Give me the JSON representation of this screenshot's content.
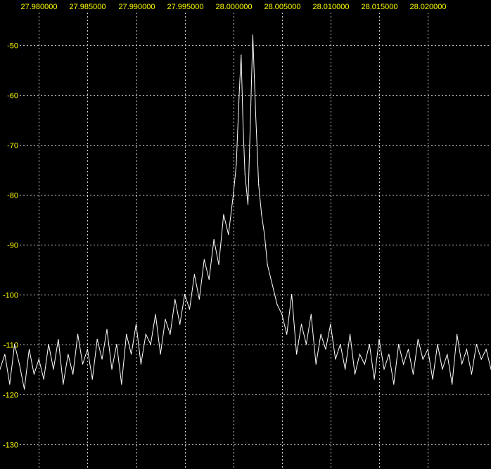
{
  "chart_data": {
    "type": "line",
    "title": "",
    "xlabel": "",
    "ylabel": "",
    "xlim": [
      27.976,
      28.0265
    ],
    "ylim": [
      -135,
      -41
    ],
    "grid": true,
    "x_ticks": [
      "27.980000",
      "27.985000",
      "27.990000",
      "27.995000",
      "28.000000",
      "28.005000",
      "28.010000",
      "28.015000",
      "28.020000"
    ],
    "y_ticks": [
      "-50",
      "-60",
      "-70",
      "-80",
      "-90",
      "-100",
      "-110",
      "-120",
      "-130"
    ],
    "series": [
      {
        "color": "#ffffff",
        "x": [
          27.976,
          27.9765,
          27.977,
          27.9775,
          27.978,
          27.9785,
          27.979,
          27.9795,
          27.98,
          27.9805,
          27.981,
          27.9815,
          27.982,
          27.9825,
          27.983,
          27.9835,
          27.984,
          27.9845,
          27.985,
          27.9855,
          27.986,
          27.9865,
          27.987,
          27.9875,
          27.988,
          27.9885,
          27.989,
          27.9895,
          27.99,
          27.9905,
          27.991,
          27.9915,
          27.992,
          27.9925,
          27.993,
          27.9935,
          27.994,
          27.9945,
          27.995,
          27.9955,
          27.996,
          27.9965,
          27.997,
          27.9975,
          27.998,
          27.9985,
          27.999,
          27.9995,
          28.0,
          28.0003,
          28.0006,
          28.0008,
          28.001,
          28.0012,
          28.0015,
          28.0018,
          28.002,
          28.0023,
          28.0026,
          28.0029,
          28.0032,
          28.0035,
          28.004,
          28.0045,
          28.005,
          28.0055,
          28.006,
          28.0065,
          28.007,
          28.0075,
          28.008,
          28.0085,
          28.009,
          28.0095,
          28.01,
          28.0105,
          28.011,
          28.0115,
          28.012,
          28.0125,
          28.013,
          28.0135,
          28.014,
          28.0145,
          28.015,
          28.0155,
          28.016,
          28.0165,
          28.017,
          28.0175,
          28.018,
          28.0185,
          28.019,
          28.0195,
          28.02,
          28.0205,
          28.021,
          28.0215,
          28.022,
          28.0225,
          28.023,
          28.0235,
          28.024,
          28.0245,
          28.025,
          28.0255,
          28.026,
          28.0265
        ],
        "y": [
          -115,
          -112,
          -118,
          -110,
          -114,
          -119,
          -111,
          -116,
          -113,
          -117,
          -110,
          -115,
          -109,
          -118,
          -112,
          -116,
          -108,
          -114,
          -111,
          -117,
          -109,
          -113,
          -107,
          -115,
          -110,
          -118,
          -108,
          -112,
          -106,
          -114,
          -108,
          -110,
          -104,
          -112,
          -105,
          -108,
          -101,
          -106,
          -100,
          -103,
          -96,
          -101,
          -93,
          -97,
          -89,
          -94,
          -84,
          -88,
          -80,
          -74,
          -60,
          -52,
          -66,
          -76,
          -82,
          -62,
          -48,
          -64,
          -78,
          -84,
          -88,
          -94,
          -98,
          -102,
          -104,
          -108,
          -100,
          -112,
          -106,
          -110,
          -104,
          -114,
          -108,
          -111,
          -106,
          -113,
          -110,
          -115,
          -108,
          -116,
          -112,
          -114,
          -110,
          -117,
          -109,
          -115,
          -112,
          -118,
          -110,
          -114,
          -111,
          -116,
          -109,
          -113,
          -111,
          -117,
          -110,
          -115,
          -112,
          -118,
          -108,
          -114,
          -111,
          -116,
          -110,
          -113,
          -111,
          -115
        ]
      }
    ]
  }
}
